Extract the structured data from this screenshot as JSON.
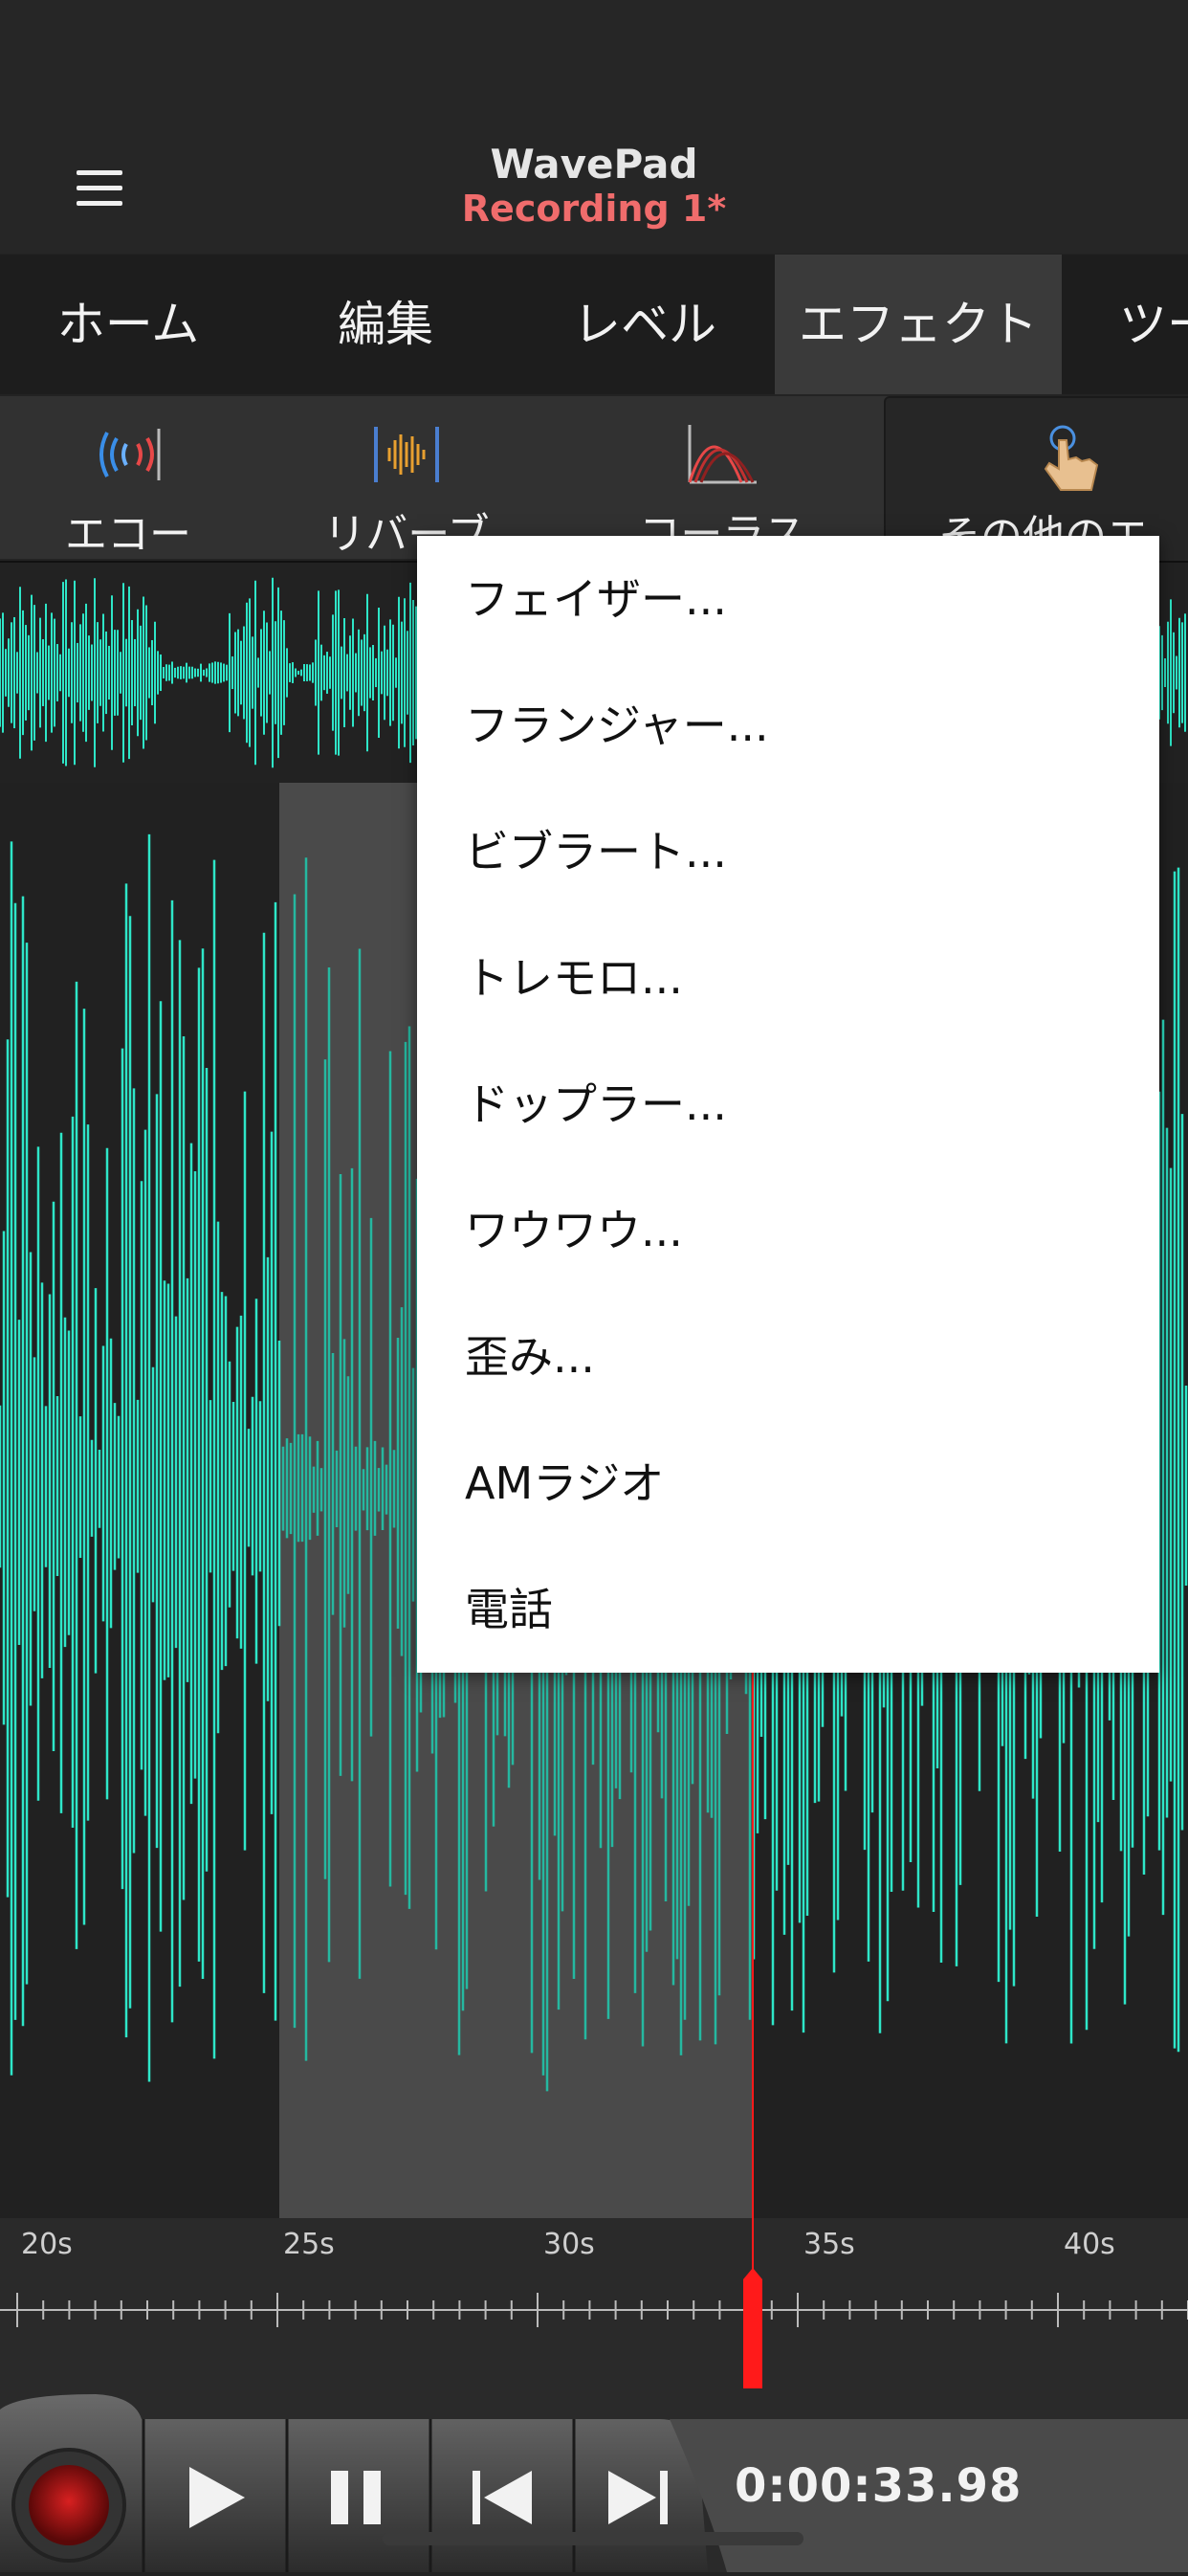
{
  "header": {
    "app_title": "WavePad",
    "doc_title": "Recording 1*"
  },
  "tabs": [
    {
      "label": "ホーム",
      "active": false
    },
    {
      "label": "編集",
      "active": false
    },
    {
      "label": "レベル",
      "active": false
    },
    {
      "label": "エフェクト",
      "active": true
    },
    {
      "label": "ツー",
      "active": false
    }
  ],
  "toolbar": {
    "items": [
      {
        "label": "エコー",
        "icon": "echo-icon"
      },
      {
        "label": "リバーブ",
        "icon": "reverb-icon"
      },
      {
        "label": "コーラス",
        "icon": "chorus-icon"
      },
      {
        "label": "その他のエ",
        "icon": "hand-pointer-icon"
      }
    ]
  },
  "popup_menu": {
    "items": [
      "フェイザー...",
      "フランジャー...",
      "ビブラート...",
      "トレモロ...",
      "ドップラー...",
      "ワウワウ...",
      "歪み...",
      "AMラジオ",
      "電話"
    ]
  },
  "timeline": {
    "labels": [
      "20s",
      "25s",
      "30s",
      "35s",
      "40s"
    ]
  },
  "transport": {
    "time": "0:00:33.98",
    "buttons": [
      "record-button",
      "play-button",
      "pause-button",
      "skip-back-button",
      "skip-forward-button"
    ]
  },
  "colors": {
    "waveform": "#2ee6c8",
    "accent_red": "#f06c6c",
    "playhead": "#ff1a1a",
    "selection": "#4a4a4a"
  }
}
